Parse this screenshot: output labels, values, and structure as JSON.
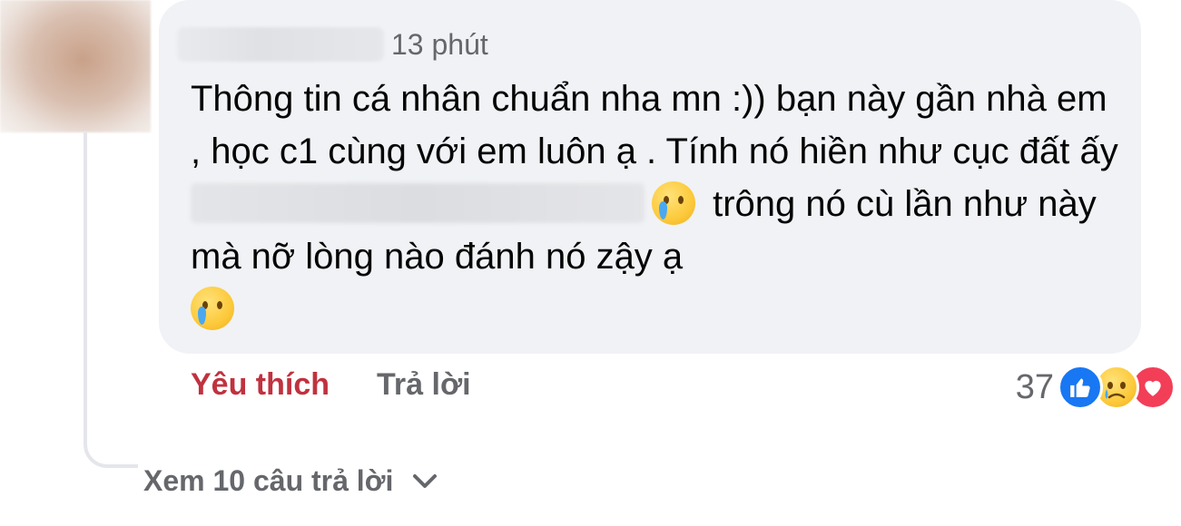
{
  "comment": {
    "timestamp": "13 phút",
    "text_part1": "Thông tin cá nhân chuẩn nha mn :)) bạn này gần nhà em , học c1 cùng với em luôn ạ . Tính nó hiền như cục đất ấy",
    "text_part2": "trông nó cù lần như này mà nỡ lòng nào đánh nó zậy ạ",
    "emoji": "crying-face-emoji"
  },
  "actions": {
    "like_label": "Yêu thích",
    "reply_label": "Trả lời"
  },
  "reactions": {
    "count": "37",
    "icons": [
      "like-icon",
      "sad-icon",
      "love-icon"
    ]
  },
  "replies": {
    "view_label": "Xem 10 câu trả lời"
  },
  "colors": {
    "bubble_bg": "#f0f2f5",
    "like_active": "#c0323f",
    "secondary_text": "#65676b",
    "like_blue": "#1877f2",
    "love_red": "#f33e58"
  }
}
